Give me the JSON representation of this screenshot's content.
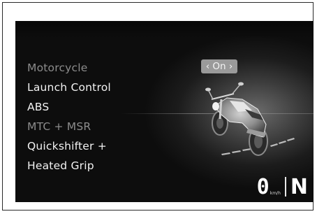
{
  "menu": {
    "items": [
      {
        "label": "Motorcycle",
        "state": "dim"
      },
      {
        "label": "Launch Control",
        "state": "normal"
      },
      {
        "label": "ABS",
        "state": "normal"
      },
      {
        "label": "MTC + MSR",
        "state": "dim"
      },
      {
        "label": "Quickshifter +",
        "state": "normal"
      },
      {
        "label": "Heated Grip",
        "state": "normal"
      }
    ],
    "selected_value": "‹ On ›"
  },
  "status": {
    "speed": "0",
    "speed_unit": "km/h",
    "gear": "N"
  },
  "icons": {
    "bike": "motorcycle-icon"
  }
}
